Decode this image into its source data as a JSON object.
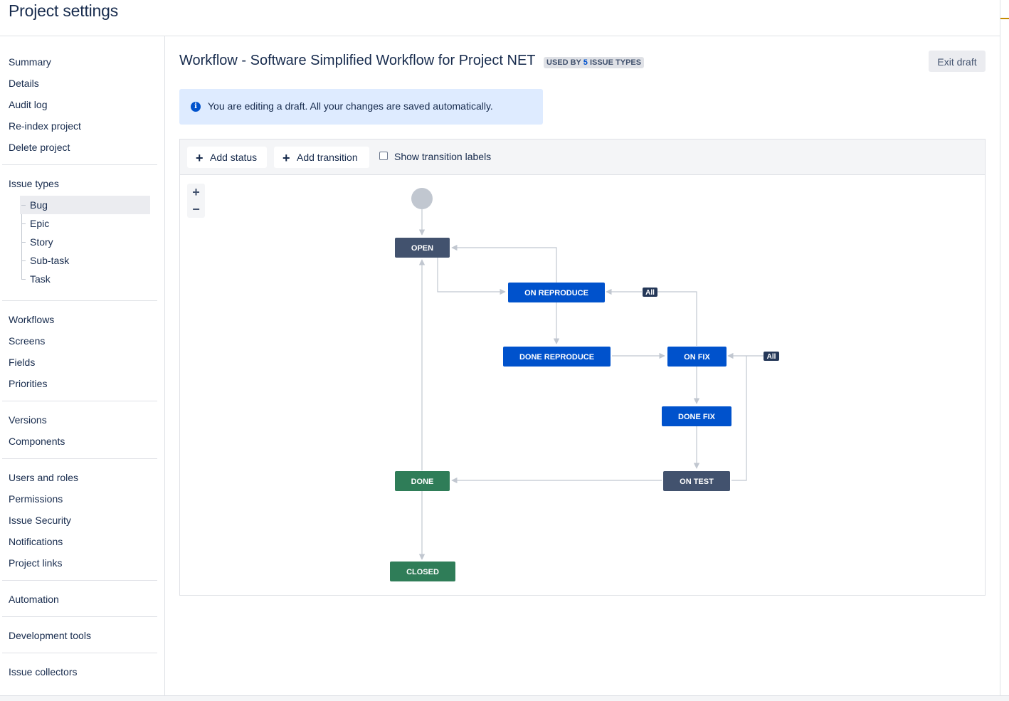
{
  "header": {
    "title": "Project settings"
  },
  "sidebar": {
    "group1": [
      "Summary",
      "Details",
      "Audit log",
      "Re-index project",
      "Delete project"
    ],
    "issue_types_label": "Issue types",
    "issue_types": [
      "Bug",
      "Epic",
      "Story",
      "Sub-task",
      "Task"
    ],
    "selected_issue_type": "Bug",
    "group3": [
      "Workflows",
      "Screens",
      "Fields",
      "Priorities"
    ],
    "group4": [
      "Versions",
      "Components"
    ],
    "group5": [
      "Users and roles",
      "Permissions",
      "Issue Security",
      "Notifications",
      "Project links"
    ],
    "group6": [
      "Automation"
    ],
    "group7": [
      "Development tools"
    ],
    "group8": [
      "Issue collectors"
    ]
  },
  "workflow": {
    "title": "Workflow - Software Simplified Workflow for Project NET",
    "badge_prefix": "USED BY ",
    "badge_count": "5",
    "badge_suffix": " ISSUE TYPES",
    "exit_label": "Exit draft"
  },
  "info": {
    "icon": "info-icon",
    "text": "You are editing a draft. All your changes are saved automatically."
  },
  "toolbar": {
    "add_status": "Add status",
    "add_transition": "Add transition",
    "show_labels": "Show transition labels",
    "show_labels_checked": false
  },
  "zoom": {
    "in": "+",
    "out": "−"
  },
  "statuses": {
    "open": "OPEN",
    "on_reproduce": "ON REPRODUCE",
    "done_reproduce": "DONE REPRODUCE",
    "on_fix": "ON FIX",
    "done_fix": "DONE FIX",
    "on_test": "ON TEST",
    "done": "DONE",
    "closed": "CLOSED",
    "all_label": "All"
  },
  "colors": {
    "todo": "#42526e",
    "in_progress": "#0052cc",
    "done": "#2f7d58",
    "all_tag": "#253858",
    "start": "#c1c7d0",
    "line": "#c1c7d0"
  }
}
